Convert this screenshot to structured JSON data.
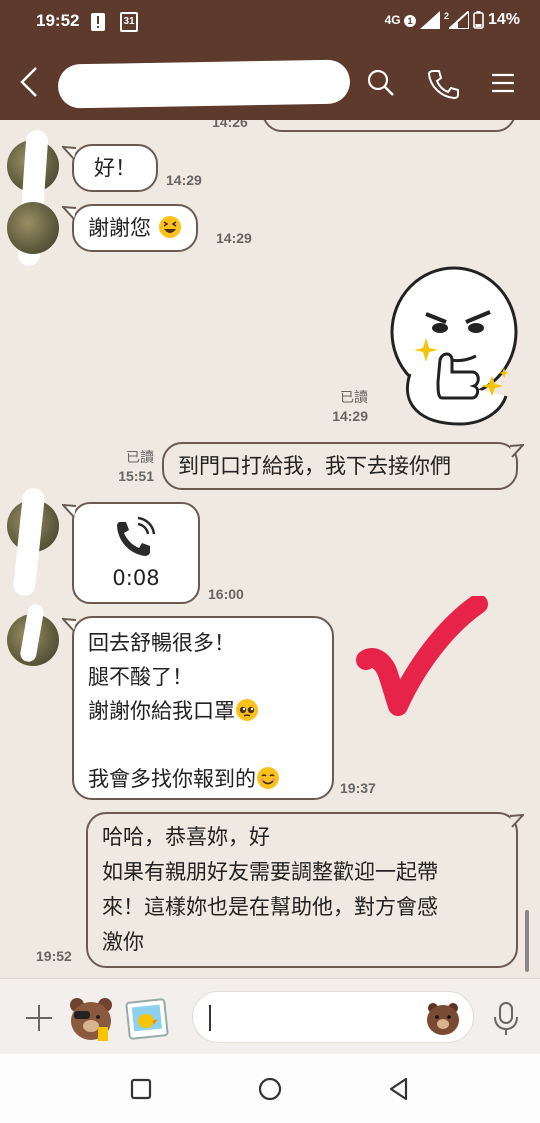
{
  "status_bar": {
    "time": "19:52",
    "calendar_day": "31",
    "network": "4G",
    "sim_badge": "1",
    "sim2_label": "2",
    "battery": "14%"
  },
  "header": {
    "title": "",
    "accent": "#5d3a2b"
  },
  "messages": [
    {
      "direction": "in",
      "text": "好！",
      "time": "14:29"
    },
    {
      "direction": "in",
      "text": "謝謝您",
      "emoji": "grinning-squint-emoji",
      "time": "14:29"
    },
    {
      "direction": "out",
      "type": "sticker",
      "sticker": "moon-thumbs-up-sticker",
      "read": "已讀",
      "time": "14:29"
    },
    {
      "direction": "out",
      "text": "到門口打給我，我下去接你們",
      "read": "已讀",
      "time": "15:51"
    },
    {
      "direction": "in",
      "type": "call",
      "duration": "0:08",
      "time": "16:00"
    },
    {
      "direction": "in",
      "lines": [
        "回去舒暢很多！",
        "腿不酸了！",
        "謝謝你給我口罩",
        "",
        "我會多找你報到的"
      ],
      "time": "19:37"
    },
    {
      "direction": "out",
      "lines": [
        "哈哈，恭喜妳，好",
        "如果有親朋好友需要調整歡迎一起帶",
        "來！這樣妳也是在幫助他，對方會感",
        "激你"
      ],
      "time": "19:52"
    }
  ],
  "earlier": {
    "time": "14:26"
  },
  "input": {
    "placeholder": ""
  },
  "colors": {
    "check_mark": "#e8234a",
    "bubble_border": "#6b5a50",
    "chat_bg": "#efe9e1"
  }
}
